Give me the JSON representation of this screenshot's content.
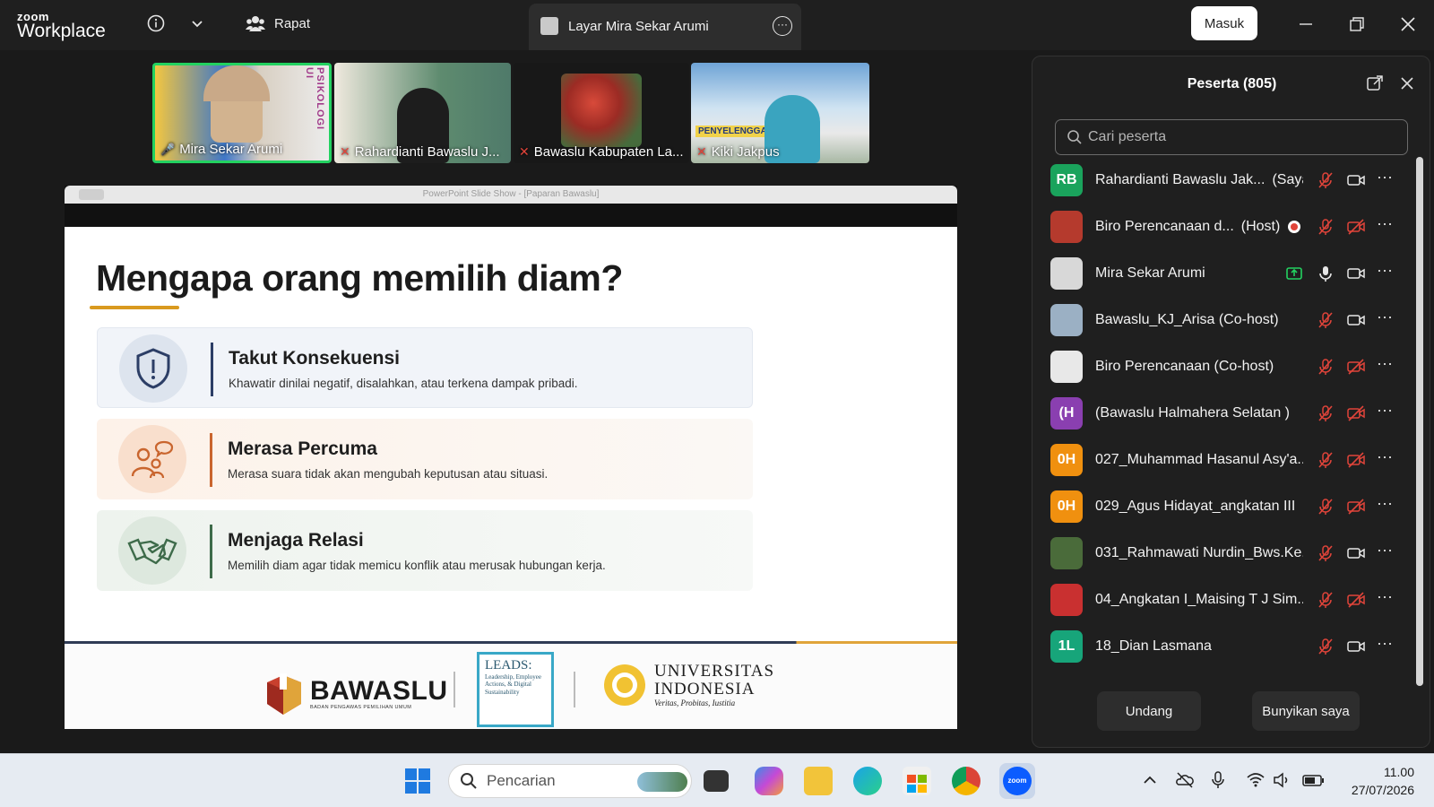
{
  "app": {
    "brand_top": "zoom",
    "brand_bottom": "Workplace"
  },
  "titlebar": {
    "meeting_label": "Rapat",
    "share_tab_label": "Layar Mira Sekar Arumi",
    "signin_label": "Masuk"
  },
  "videos": [
    {
      "name": "Mira Sekar Arumi",
      "muted": false,
      "active": true
    },
    {
      "name": "Rahardianti Bawaslu J...",
      "muted": true
    },
    {
      "name": "Bawaslu Kabupaten La...",
      "muted": true
    },
    {
      "name": "Kiki Jakpus",
      "muted": true
    }
  ],
  "video_overlay_text": {
    "psikologi": "PSIKOLOGI UI",
    "banner": "PENYELENGGARAAN"
  },
  "slideshow": {
    "window_title": "PowerPoint Slide Show - [Paparan Bawaslu]",
    "title": "Mengapa orang memilih diam?",
    "cards": [
      {
        "title": "Takut Konsekuensi",
        "desc": "Khawatir dinilai negatif, disalahkan, atau terkena dampak pribadi.",
        "icon": "shield-alert-icon"
      },
      {
        "title": "Merasa Percuma",
        "desc": "Merasa suara tidak akan mengubah keputusan atau situasi.",
        "icon": "people-thought-icon"
      },
      {
        "title": "Menjaga Relasi",
        "desc": "Memilih diam agar tidak memicu konflik atau merusak hubungan kerja.",
        "icon": "handshake-icon"
      }
    ],
    "logos": {
      "bawaslu": "BAWASLU",
      "bawaslu_sub": "BADAN PENGAWAS PEMILIHAN UMUM",
      "leads_title": "LEADS:",
      "leads_sub": "Leadership, Employee Actions, & Digital Sustainability",
      "ui_name_1": "UNIVERSITAS",
      "ui_name_2": "INDONESIA",
      "ui_motto": "Veritas, Probitas, Iustitia"
    }
  },
  "participants": {
    "title": "Peserta (805)",
    "search_placeholder": "Cari peserta",
    "list": [
      {
        "initials": "RB",
        "color": "#1aa35c",
        "name": "Rahardianti Bawaslu Jak...",
        "role": "(Saya)",
        "mic": "muted",
        "video": "on"
      },
      {
        "initials": "",
        "color": "#b53a2d",
        "name": "Biro Perencanaan d...",
        "role": "(Host)",
        "mic": "muted",
        "video": "off",
        "recording": true
      },
      {
        "initials": "",
        "color": "#d8d8d8",
        "name": "Mira Sekar Arumi",
        "role": "",
        "mic": "on",
        "video": "on",
        "sharing": true
      },
      {
        "initials": "",
        "color": "#9bb0c4",
        "name": "Bawaslu_KJ_Arisa (Co-host)",
        "role": "",
        "mic": "muted",
        "video": "on"
      },
      {
        "initials": "",
        "color": "#e8e8e8",
        "name": "Biro Perencanaan (Co-host)",
        "role": "",
        "mic": "muted",
        "video": "off"
      },
      {
        "initials": "(H",
        "color": "#8a3fb0",
        "name": "(Bawaslu  Halmahera Selatan )",
        "role": "",
        "mic": "muted",
        "video": "off"
      },
      {
        "initials": "0H",
        "color": "#f0900f",
        "name": "027_Muhammad Hasanul Asy'a...",
        "role": "",
        "mic": "muted",
        "video": "off"
      },
      {
        "initials": "0H",
        "color": "#f0900f",
        "name": "029_Agus Hidayat_angkatan III",
        "role": "",
        "mic": "muted",
        "video": "off"
      },
      {
        "initials": "",
        "color": "#4a6b3a",
        "name": "031_Rahmawati Nurdin_Bws.Ke...",
        "role": "",
        "mic": "muted",
        "video": "on"
      },
      {
        "initials": "",
        "color": "#c93030",
        "name": "04_Angkatan I_Maising T J Sim...",
        "role": "",
        "mic": "muted",
        "video": "off"
      },
      {
        "initials": "1L",
        "color": "#17a57a",
        "name": "18_Dian Lasmana",
        "role": "",
        "mic": "muted",
        "video": "on"
      }
    ],
    "invite_label": "Undang",
    "unmute_label": "Bunyikan saya"
  },
  "taskbar": {
    "search_placeholder": "Pencarian",
    "time": "11.00",
    "date": "27/07/2026"
  },
  "colors": {
    "accent_green": "#1aa35c",
    "mute_red": "#e0443a",
    "slide_underline": "#d99a1f"
  }
}
